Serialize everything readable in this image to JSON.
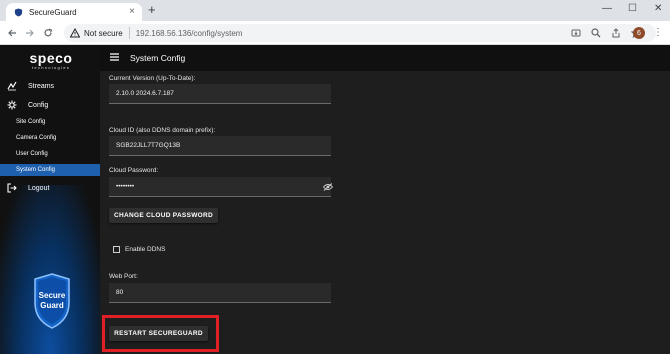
{
  "browser": {
    "tab_title": "SecureGuard",
    "tab_close": "×",
    "new_tab": "+",
    "window_minimize": "—",
    "window_maximize": "☐",
    "window_close": "✕",
    "security_chip": "Not secure",
    "url": "192.168.56.136/config/system",
    "profile_initial": "6"
  },
  "sidebar": {
    "logo_word": "speco",
    "logo_sub": "technologies",
    "items": [
      {
        "label": "Streams",
        "icon": "streams-icon"
      },
      {
        "label": "Config",
        "icon": "gear-icon"
      }
    ],
    "sub_items": [
      {
        "label": "Site Config",
        "active": false
      },
      {
        "label": "Camera Config",
        "active": false
      },
      {
        "label": "User Config",
        "active": false
      },
      {
        "label": "System Config",
        "active": true
      }
    ],
    "logout": "Logout",
    "badge_line1": "Secure",
    "badge_line2": "Guard"
  },
  "appbar": {
    "title": "System Config"
  },
  "form": {
    "version_label": "Current Version (Up-To-Date):",
    "version_value": "2.10.0 2024.6.7.187",
    "cloud_id_label": "Cloud ID (also DDNS domain prefix):",
    "cloud_id_value": "SGB22JLL7T7GQ13B",
    "cloud_password_label": "Cloud Password:",
    "cloud_password_value": "••••••••",
    "change_password_button": "CHANGE CLOUD PASSWORD",
    "enable_ddns_label": "Enable DDNS",
    "enable_ddns_checked": false,
    "web_port_label": "Web Port:",
    "web_port_value": "80",
    "restart_button": "RESTART SECUREGUARD"
  },
  "colors": {
    "accent": "#1e5fae",
    "highlight": "#e01f26",
    "background": "#1e1e1e"
  }
}
